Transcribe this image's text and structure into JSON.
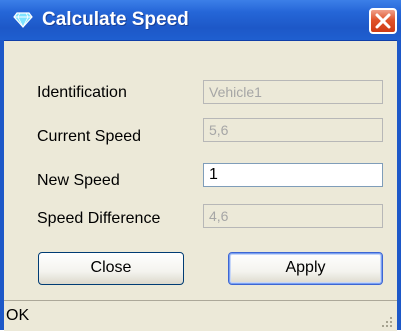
{
  "window": {
    "title": "Calculate Speed",
    "icon": "diamond-icon",
    "close_icon": "close-icon"
  },
  "form": {
    "fields": [
      {
        "label": "Identification",
        "value": "Vehicle1",
        "editable": false
      },
      {
        "label": "Current Speed",
        "value": "5,6",
        "editable": false
      },
      {
        "label": "New Speed",
        "value": "1",
        "editable": true
      },
      {
        "label": "Speed Difference",
        "value": "4,6",
        "editable": false
      }
    ]
  },
  "buttons": {
    "close_label": "Close",
    "apply_label": "Apply"
  },
  "status": {
    "text": "OK"
  },
  "colors": {
    "titlebar": "#1d58c8",
    "client_bg": "#ece9d8",
    "close_btn": "#e0532b"
  }
}
